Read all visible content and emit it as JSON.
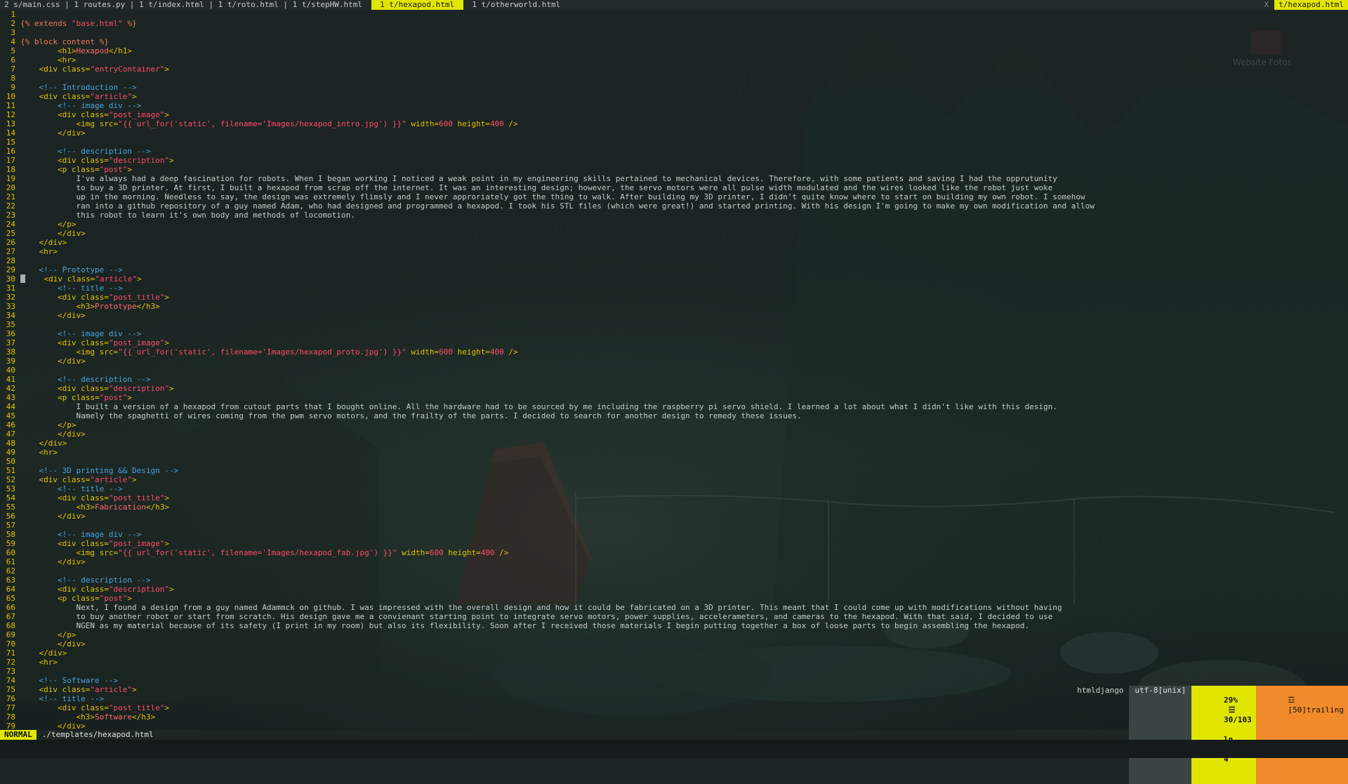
{
  "tabs": {
    "items": [
      {
        "label": "2 s/main.css | 1 routes.py | 1 t/index.html | 1 t/roto.html | 1 t/stepHW.html ",
        "active": false
      },
      {
        "label": " 1 t/hexapod.html ",
        "active": true
      },
      {
        "label": " 1 t/otherworld.html ",
        "active": false
      }
    ],
    "close_label": "X",
    "right_file": "t/hexapod.html"
  },
  "desktop": {
    "watermark": "Website Fotos"
  },
  "editor": {
    "lines": [
      [],
      [
        [
          "t-tpl",
          "{% extends "
        ],
        [
          "t-str",
          "\"base.html\""
        ],
        [
          "t-tpl",
          " %}"
        ]
      ],
      [],
      [
        [
          "t-tpl",
          "{% block content %}"
        ]
      ],
      [
        [
          "t-txt",
          "        "
        ],
        [
          "t-tag",
          "<h1>"
        ],
        [
          "t-name",
          "Hexapod"
        ],
        [
          "t-tag",
          "</h1>"
        ]
      ],
      [
        [
          "t-txt",
          "        "
        ],
        [
          "t-tag",
          "<hr>"
        ]
      ],
      [
        [
          "t-txt",
          "    "
        ],
        [
          "t-tag",
          "<div "
        ],
        [
          "t-attr",
          "class="
        ],
        [
          "t-str",
          "\"entryContainer\""
        ],
        [
          "t-tag",
          ">"
        ]
      ],
      [],
      [
        [
          "t-txt",
          "    "
        ],
        [
          "t-com",
          "<!-- Introduction -->"
        ]
      ],
      [
        [
          "t-txt",
          "    "
        ],
        [
          "t-tag",
          "<div "
        ],
        [
          "t-attr",
          "class="
        ],
        [
          "t-str",
          "\"article\""
        ],
        [
          "t-tag",
          ">"
        ]
      ],
      [
        [
          "t-txt",
          "        "
        ],
        [
          "t-com",
          "<!-- image div -->"
        ]
      ],
      [
        [
          "t-txt",
          "        "
        ],
        [
          "t-tag",
          "<div "
        ],
        [
          "t-attr",
          "class="
        ],
        [
          "t-str",
          "\"post_image\""
        ],
        [
          "t-tag",
          ">"
        ]
      ],
      [
        [
          "t-txt",
          "            "
        ],
        [
          "t-tag",
          "<img "
        ],
        [
          "t-attr",
          "src="
        ],
        [
          "t-str",
          "\"{{ url_for('static', filename='Images/hexapod_intro.jpg') }}\""
        ],
        [
          "t-attr",
          " width="
        ],
        [
          "t-num",
          "600"
        ],
        [
          "t-attr",
          " height="
        ],
        [
          "t-num",
          "400"
        ],
        [
          "t-tag",
          " />"
        ]
      ],
      [
        [
          "t-txt",
          "        "
        ],
        [
          "t-tag",
          "</div>"
        ]
      ],
      [],
      [
        [
          "t-txt",
          "        "
        ],
        [
          "t-com",
          "<!-- description -->"
        ]
      ],
      [
        [
          "t-txt",
          "        "
        ],
        [
          "t-tag",
          "<div "
        ],
        [
          "t-attr",
          "class="
        ],
        [
          "t-str",
          "\"description\""
        ],
        [
          "t-tag",
          ">"
        ]
      ],
      [
        [
          "t-txt",
          "        "
        ],
        [
          "t-tag",
          "<p "
        ],
        [
          "t-attr",
          "class="
        ],
        [
          "t-str",
          "\"post\""
        ],
        [
          "t-tag",
          ">"
        ]
      ],
      [
        [
          "t-txt",
          "            I've always had a deep fascination for robots. When I began working I noticed a weak point in my engineering skills pertained to mechanical devices. Therefore, with some patients and saving I had the opprutunity"
        ]
      ],
      [
        [
          "t-txt",
          "            to buy a 3D printer. At first, I built a hexapod from scrap off the internet. It was an interesting design; however, the servo motors were all pulse width modulated and the wires looked like the robot just woke"
        ]
      ],
      [
        [
          "t-txt",
          "            up in the morning. Needless to say, the design was extremely flimsly and I never approriately got the thing to walk. After building my 3D printer, I didn't quite know where to start on building my own robot. I somehow"
        ]
      ],
      [
        [
          "t-txt",
          "            ran into a github repository of a guy named Adam, who had designed and programmed a hexapod. I took his STL files (which were great!) and started printing. With his design I'm going to make my own modification and allow"
        ]
      ],
      [
        [
          "t-txt",
          "            this robot to learn it's own body and methods of locomotion."
        ]
      ],
      [
        [
          "t-txt",
          "        "
        ],
        [
          "t-tag",
          "</p>"
        ]
      ],
      [
        [
          "t-txt",
          "        "
        ],
        [
          "t-tag",
          "</div>"
        ]
      ],
      [
        [
          "t-txt",
          "    "
        ],
        [
          "t-tag",
          "</div>"
        ]
      ],
      [
        [
          "t-txt",
          "    "
        ],
        [
          "t-tag",
          "<hr>"
        ]
      ],
      [],
      [
        [
          "t-txt",
          "    "
        ],
        [
          "t-com",
          "<!-- Prototype -->"
        ]
      ],
      [
        [
          "cursor",
          ""
        ],
        [
          "t-txt",
          "    "
        ],
        [
          "t-tag",
          "<div "
        ],
        [
          "t-attr",
          "class="
        ],
        [
          "t-str",
          "\"article\""
        ],
        [
          "t-tag",
          ">"
        ]
      ],
      [
        [
          "t-txt",
          "        "
        ],
        [
          "t-com",
          "<!-- title -->"
        ]
      ],
      [
        [
          "t-txt",
          "        "
        ],
        [
          "t-tag",
          "<div "
        ],
        [
          "t-attr",
          "class="
        ],
        [
          "t-str",
          "\"post_title\""
        ],
        [
          "t-tag",
          ">"
        ]
      ],
      [
        [
          "t-txt",
          "            "
        ],
        [
          "t-tag",
          "<h3>"
        ],
        [
          "t-name",
          "Prototype"
        ],
        [
          "t-tag",
          "</h3>"
        ]
      ],
      [
        [
          "t-txt",
          "        "
        ],
        [
          "t-tag",
          "</div>"
        ]
      ],
      [],
      [
        [
          "t-txt",
          "        "
        ],
        [
          "t-com",
          "<!-- image div -->"
        ]
      ],
      [
        [
          "t-txt",
          "        "
        ],
        [
          "t-tag",
          "<div "
        ],
        [
          "t-attr",
          "class="
        ],
        [
          "t-str",
          "\"post_image\""
        ],
        [
          "t-tag",
          ">"
        ]
      ],
      [
        [
          "t-txt",
          "            "
        ],
        [
          "t-tag",
          "<img "
        ],
        [
          "t-attr",
          "src="
        ],
        [
          "t-str",
          "\"{{ url_for('static', filename='Images/hexapod_proto.jpg') }}\""
        ],
        [
          "t-attr",
          " width="
        ],
        [
          "t-num",
          "600"
        ],
        [
          "t-attr",
          " height="
        ],
        [
          "t-num",
          "400"
        ],
        [
          "t-tag",
          " />"
        ]
      ],
      [
        [
          "t-txt",
          "        "
        ],
        [
          "t-tag",
          "</div>"
        ]
      ],
      [],
      [
        [
          "t-txt",
          "        "
        ],
        [
          "t-com",
          "<!-- description -->"
        ]
      ],
      [
        [
          "t-txt",
          "        "
        ],
        [
          "t-tag",
          "<div "
        ],
        [
          "t-attr",
          "class="
        ],
        [
          "t-str",
          "\"description\""
        ],
        [
          "t-tag",
          ">"
        ]
      ],
      [
        [
          "t-txt",
          "        "
        ],
        [
          "t-tag",
          "<p "
        ],
        [
          "t-attr",
          "class="
        ],
        [
          "t-str",
          "\"post\""
        ],
        [
          "t-tag",
          ">"
        ]
      ],
      [
        [
          "t-txt",
          "            I built a version of a hexapod from cutout parts that I bought online. All the hardware had to be sourced by me including the raspberry pi servo shield. I learned a lot about what I didn't like with this design."
        ]
      ],
      [
        [
          "t-txt",
          "            Namely the spaghetti of wires coming from the pwm servo motors, and the frailty of the parts. I decided to search for another design to remedy these issues."
        ]
      ],
      [
        [
          "t-txt",
          "        "
        ],
        [
          "t-tag",
          "</p>"
        ]
      ],
      [
        [
          "t-txt",
          "        "
        ],
        [
          "t-tag",
          "</div>"
        ]
      ],
      [
        [
          "t-txt",
          "    "
        ],
        [
          "t-tag",
          "</div>"
        ]
      ],
      [
        [
          "t-txt",
          "    "
        ],
        [
          "t-tag",
          "<hr>"
        ]
      ],
      [],
      [
        [
          "t-txt",
          "    "
        ],
        [
          "t-com",
          "<!-- 3D printing && Design -->"
        ]
      ],
      [
        [
          "t-txt",
          "    "
        ],
        [
          "t-tag",
          "<div "
        ],
        [
          "t-attr",
          "class="
        ],
        [
          "t-str",
          "\"article\""
        ],
        [
          "t-tag",
          ">"
        ]
      ],
      [
        [
          "t-txt",
          "        "
        ],
        [
          "t-com",
          "<!-- title -->"
        ]
      ],
      [
        [
          "t-txt",
          "        "
        ],
        [
          "t-tag",
          "<div "
        ],
        [
          "t-attr",
          "class="
        ],
        [
          "t-str",
          "\"post_title\""
        ],
        [
          "t-tag",
          ">"
        ]
      ],
      [
        [
          "t-txt",
          "            "
        ],
        [
          "t-tag",
          "<h3>"
        ],
        [
          "t-name",
          "Fabrication"
        ],
        [
          "t-tag",
          "</h3>"
        ]
      ],
      [
        [
          "t-txt",
          "        "
        ],
        [
          "t-tag",
          "</div>"
        ]
      ],
      [],
      [
        [
          "t-txt",
          "        "
        ],
        [
          "t-com",
          "<!-- image div -->"
        ]
      ],
      [
        [
          "t-txt",
          "        "
        ],
        [
          "t-tag",
          "<div "
        ],
        [
          "t-attr",
          "class="
        ],
        [
          "t-str",
          "\"post_image\""
        ],
        [
          "t-tag",
          ">"
        ]
      ],
      [
        [
          "t-txt",
          "            "
        ],
        [
          "t-tag",
          "<img "
        ],
        [
          "t-attr",
          "src="
        ],
        [
          "t-str",
          "\"{{ url_for('static', filename='Images/hexapod_fab.jpg') }}\""
        ],
        [
          "t-attr",
          " width="
        ],
        [
          "t-num",
          "600"
        ],
        [
          "t-attr",
          " height="
        ],
        [
          "t-num",
          "400"
        ],
        [
          "t-tag",
          " />"
        ]
      ],
      [
        [
          "t-txt",
          "        "
        ],
        [
          "t-tag",
          "</div>"
        ]
      ],
      [],
      [
        [
          "t-txt",
          "        "
        ],
        [
          "t-com",
          "<!-- description -->"
        ]
      ],
      [
        [
          "t-txt",
          "        "
        ],
        [
          "t-tag",
          "<div "
        ],
        [
          "t-attr",
          "class="
        ],
        [
          "t-str",
          "\"description\""
        ],
        [
          "t-tag",
          ">"
        ]
      ],
      [
        [
          "t-txt",
          "        "
        ],
        [
          "t-tag",
          "<p "
        ],
        [
          "t-attr",
          "class="
        ],
        [
          "t-str",
          "\"post\""
        ],
        [
          "t-tag",
          ">"
        ]
      ],
      [
        [
          "t-txt",
          "            Next, I found a design from a guy named Adammck on github. I was impressed with the overall design and how it could be fabricated on a 3D printer. This meant that I could come up with modifications without having"
        ]
      ],
      [
        [
          "t-txt",
          "            to buy another robot or start from scratch. His design gave me a convienant starting point to integrate servo motors, power supplies, accelerameters, and cameras to the hexapod. With that said, I decided to use"
        ]
      ],
      [
        [
          "t-txt",
          "            NGEN as my material because of its safety (I print in my room) but also its flexibility. Soon after I received those materials I begin putting together a box of loose parts to begin assembling the hexapod."
        ]
      ],
      [
        [
          "t-txt",
          "        "
        ],
        [
          "t-tag",
          "</p>"
        ]
      ],
      [
        [
          "t-txt",
          "        "
        ],
        [
          "t-tag",
          "</div>"
        ]
      ],
      [
        [
          "t-txt",
          "    "
        ],
        [
          "t-tag",
          "</div>"
        ]
      ],
      [
        [
          "t-txt",
          "    "
        ],
        [
          "t-tag",
          "<hr>"
        ]
      ],
      [],
      [
        [
          "t-txt",
          "    "
        ],
        [
          "t-com",
          "<!-- Software -->"
        ]
      ],
      [
        [
          "t-txt",
          "    "
        ],
        [
          "t-tag",
          "<div "
        ],
        [
          "t-attr",
          "class="
        ],
        [
          "t-str",
          "\"article\""
        ],
        [
          "t-tag",
          ">"
        ]
      ],
      [
        [
          "t-txt",
          "    "
        ],
        [
          "t-com",
          "<!-- title -->"
        ]
      ],
      [
        [
          "t-txt",
          "        "
        ],
        [
          "t-tag",
          "<div "
        ],
        [
          "t-attr",
          "class="
        ],
        [
          "t-str",
          "\"post_title\""
        ],
        [
          "t-tag",
          ">"
        ]
      ],
      [
        [
          "t-txt",
          "            "
        ],
        [
          "t-tag",
          "<h3>"
        ],
        [
          "t-name",
          "Software"
        ],
        [
          "t-tag",
          "</h3>"
        ]
      ],
      [
        [
          "t-txt",
          "        "
        ],
        [
          "t-tag",
          "</div>"
        ]
      ]
    ]
  },
  "statusline": {
    "mode": "NORMAL",
    "filepath": "./templates/hexapod.html",
    "filetype": "htmldjango",
    "encoding": "utf-8[unix]",
    "percent": "29%",
    "position": "30/103",
    "column": "4",
    "line_icon": "ln",
    "warning": "[50]trailing"
  },
  "colors": {
    "accent": "#e1e600",
    "warning": "#f08a2a",
    "line_numbers": "#e6c200",
    "comment": "#4aa3e0",
    "string": "#ff4a6b"
  }
}
